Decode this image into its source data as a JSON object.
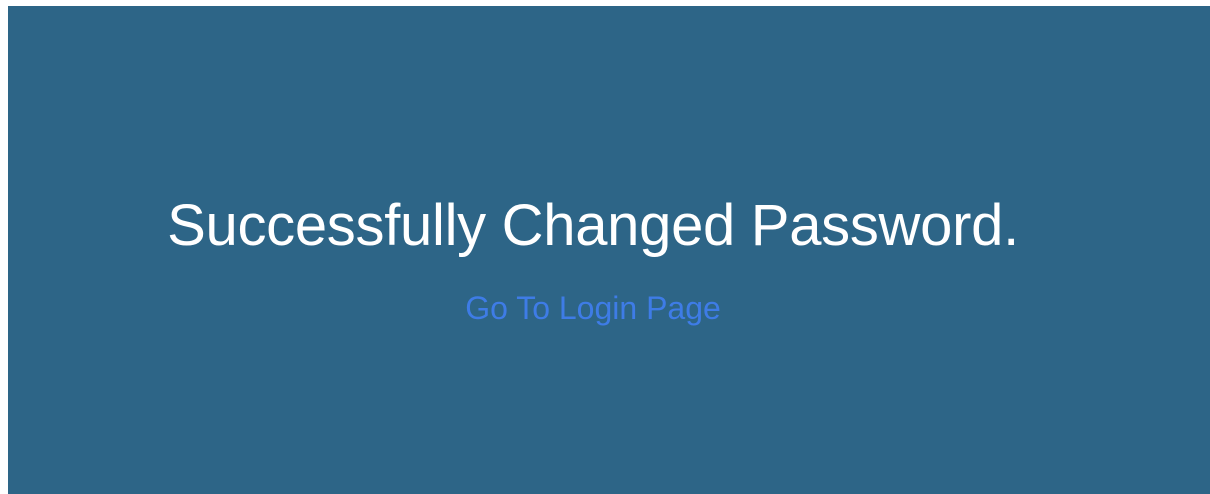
{
  "success": {
    "message": "Successfully Changed Password.",
    "login_link_label": "Go To Login Page"
  },
  "colors": {
    "background": "#2d6587",
    "message_text": "#ffffff",
    "link_text": "#3e7ce6"
  }
}
